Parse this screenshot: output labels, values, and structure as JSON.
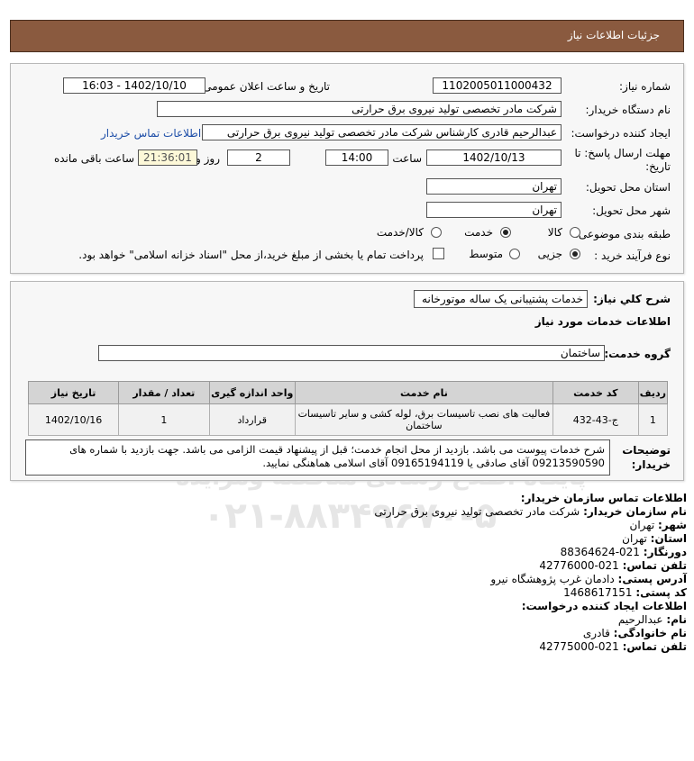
{
  "header": {
    "title": "جزئیات اطلاعات نیاز"
  },
  "need_info": {
    "need_number_label": "شماره نیاز:",
    "need_number": "1102005011000432",
    "announce_label": "تاریخ و ساعت اعلان عمومی:",
    "announce_value": "1402/10/10 - 16:03",
    "buyer_label": "نام دستگاه خریدار:",
    "buyer_value": "شرکت مادر تخصصی تولید نیروی برق حرارتی",
    "creator_label": "ایجاد کننده درخواست:",
    "creator_value": "عبدالرحیم قادری کارشناس شرکت مادر تخصصی تولید نیروی برق حرارتی",
    "contact_link": "اطلاعات تماس خریدار",
    "deadline_label_1": "مهلت ارسال پاسخ: تا",
    "deadline_label_2": "تاریخ:",
    "deadline_date": "1402/10/13",
    "time_label": "ساعت",
    "deadline_time": "14:00",
    "days_value": "2",
    "days_label": "روز و",
    "remaining_time": "21:36:01",
    "remaining_label": "ساعت باقی مانده",
    "province_label": "استان محل تحویل:",
    "province_value": "تهران",
    "city_label": "شهر محل تحویل:",
    "city_value": "تهران",
    "category_label": "طبقه بندی موضوعی:",
    "category_options": [
      "کالا",
      "خدمت",
      "کالا/خدمت"
    ],
    "category_selected": "خدمت",
    "process_label": "نوع فرآیند خرید :",
    "process_options": [
      "جزیی",
      "متوسط"
    ],
    "process_selected": "جزیی",
    "payment_note": "پرداخت تمام یا بخشی از مبلغ خرید،از محل \"اسناد خزانه اسلامی\" خواهد بود."
  },
  "description": {
    "general_label": "شرح کلي نياز:",
    "general_value": "خدمات پشتیبانی یک ساله موتورخانه",
    "services_heading": "اطلاعات خدمات مورد نیاز",
    "group_label": "گروه خدمت:",
    "group_value": "ساختمان",
    "table": {
      "headers": [
        "ردیف",
        "کد خدمت",
        "نام خدمت",
        "واحد اندازه گیری",
        "تعداد / مقدار",
        "تاریخ نیاز"
      ],
      "rows": [
        [
          "1",
          "ج-43-432",
          "فعالیت های نصب تاسیسات برق، لوله کشی و سایر تاسیسات ساختمان",
          "قرارداد",
          "1",
          "1402/10/16"
        ]
      ]
    },
    "buyer_notes_label_1": "توضیحات",
    "buyer_notes_label_2": "خریدار:",
    "buyer_notes": "شرح خدمات پیوست می باشد. بازدید از محل انجام خدمت؛ قبل از پیشنهاد قیمت الزامی می باشد. جهت بازدید با شماره های 09213590590 آقای صادقی یا 09165194119 آقای اسلامی هماهنگی نمایید."
  },
  "buyer_contact": {
    "heading": "اطلاعات تماس سازمان خریدار:",
    "org_label": "نام سازمان خریدار:",
    "org_value": "شرکت مادر تخصصی تولید نیروی برق حرارتی",
    "city_label": "شهر:",
    "city_value": "تهران",
    "province_label": "استان:",
    "province_value": "تهران",
    "fax_label": "دورنگار:",
    "fax_value": "021-88364624",
    "phone_label": "تلفن تماس:",
    "phone_value": "021-42776000",
    "address_label": "آدرس پستی:",
    "address_value": "دادمان غرب پژوهشگاه نیرو",
    "postal_label": "کد پستی:",
    "postal_value": "1468617151"
  },
  "creator_contact": {
    "heading": "اطلاعات ایجاد کننده درخواست:",
    "name_label": "نام:",
    "name_value": "عبدالرحیم",
    "family_label": "نام خانوادگی:",
    "family_value": "قادری",
    "phone_label": "تلفن تماس:",
    "phone_value": "021-42775000"
  },
  "watermark": {
    "brand": "ParsNamadData",
    "slogan": "پایگاه اطلاع رسانی مناقصه ومزایده",
    "phone": "۰۲۱-۸۸۳۴۹۶۷۰-۵"
  }
}
